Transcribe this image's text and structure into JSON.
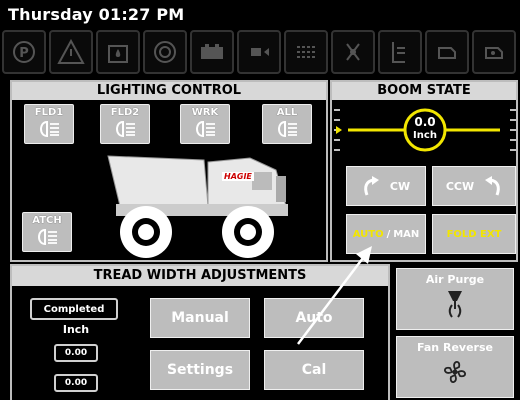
{
  "status": {
    "datetime": "Thursday 01:27 PM"
  },
  "warning_icons": [
    "parking-brake-icon",
    "warning-triangle-icon",
    "water-in-fuel-icon",
    "air-filter-icon",
    "battery-icon",
    "engine-oil-icon",
    "coolant-temp-icon",
    "fan-icon",
    "fuel-level-icon",
    "engine-check-icon",
    "engine-preheat-icon"
  ],
  "lighting": {
    "title": "LIGHTING CONTROL",
    "buttons": [
      "FLD1",
      "FLD2",
      "WRK",
      "ALL"
    ],
    "attach_label": "ATCH",
    "brand_label": "HAGIE"
  },
  "boom": {
    "title": "BOOM STATE",
    "value": "0.0",
    "unit": "Inch",
    "cw_label": "CW",
    "ccw_label": "CCW",
    "auto_label": "AUTO",
    "separator": "/",
    "man_label": "MAN",
    "fold_label": "FOLD EXT",
    "accent_color": "#f2e600"
  },
  "tread": {
    "title": "TREAD WIDTH ADJUSTMENTS",
    "status_label": "Completed",
    "unit_label": "Inch",
    "left_value": "0.00",
    "right_value": "0.00",
    "manual_label": "Manual",
    "auto_label": "Auto",
    "settings_label": "Settings",
    "cal_label": "Cal"
  },
  "side": {
    "air_purge_label": "Air Purge",
    "fan_reverse_label": "Fan Reverse"
  }
}
